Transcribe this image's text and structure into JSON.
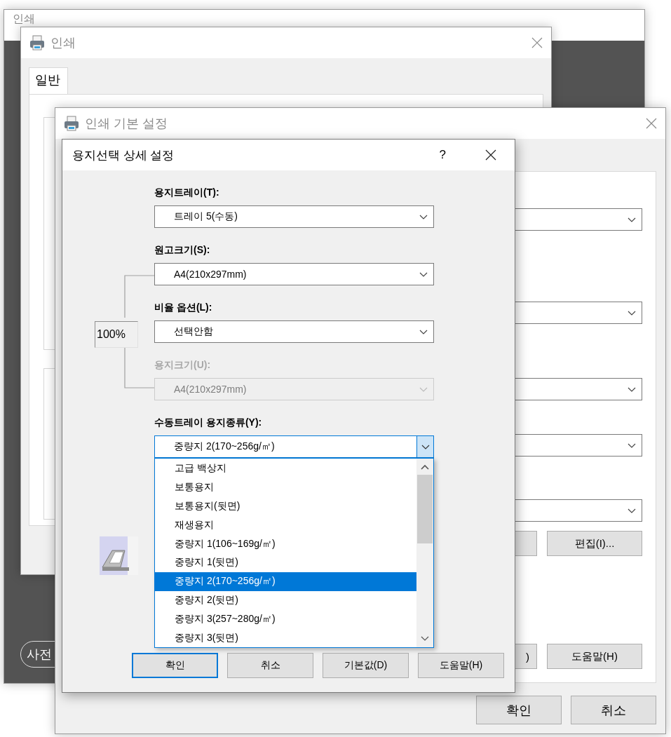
{
  "background_window": {
    "title": "인쇄",
    "button": "사전"
  },
  "print_window": {
    "title": "인쇄",
    "tabs": [
      {
        "label": "일반",
        "selected": true
      }
    ]
  },
  "preferences_window": {
    "title": "인쇄 기본 설정",
    "combo_boxes": [
      {
        "kind": "combo"
      },
      {
        "kind": "combo"
      },
      {
        "kind": "combo"
      },
      {
        "kind": "combo"
      },
      {
        "kind": "combo"
      }
    ],
    "button_rows": [
      {
        "buttons": [
          {
            "kind": "blank"
          },
          {
            "kind": "text",
            "label": "편집(I)..."
          }
        ]
      },
      {
        "buttons": [
          {
            "kind": "text",
            "label": ")"
          },
          {
            "kind": "text",
            "label": "도움말(H)"
          }
        ]
      }
    ],
    "footer_buttons": [
      "확인",
      "취소"
    ]
  },
  "paper_dialog": {
    "title": "용지선택 상세 설정",
    "help": "?",
    "scale": "100%",
    "fields": [
      {
        "label": "용지트레이(T):",
        "value": "트레이 5(수동)",
        "disabled": false,
        "expanded": false
      },
      {
        "label": "원고크기(S):",
        "value": "A4(210x297mm)",
        "disabled": false,
        "expanded": false
      },
      {
        "label": "비율 옵션(L):",
        "value": "선택안함",
        "disabled": false,
        "expanded": false
      },
      {
        "label": "용지크기(U):",
        "value": "A4(210x297mm)",
        "disabled": true,
        "expanded": false
      },
      {
        "label": "수동트레이 용지종류(Y):",
        "value": "중량지 2(170~256g/㎡)",
        "disabled": false,
        "expanded": true,
        "options": [
          {
            "label": "고급 백상지",
            "selected": false
          },
          {
            "label": "보통용지",
            "selected": false
          },
          {
            "label": "보통용지(뒷면)",
            "selected": false
          },
          {
            "label": "재생용지",
            "selected": false
          },
          {
            "label": "중량지 1(106~169g/㎡)",
            "selected": false
          },
          {
            "label": "중량지 1(뒷면)",
            "selected": false
          },
          {
            "label": "중량지 2(170~256g/㎡)",
            "selected": true
          },
          {
            "label": "중량지 2(뒷면)",
            "selected": false
          },
          {
            "label": "중량지 3(257~280g/㎡)",
            "selected": false
          },
          {
            "label": "중량지 3(뒷면)",
            "selected": false
          }
        ]
      }
    ],
    "buttons": [
      {
        "label": "확인",
        "default": true
      },
      {
        "label": "취소",
        "default": false
      },
      {
        "label": "기본값(D)",
        "default": false
      },
      {
        "label": "도움말(H)",
        "default": false
      }
    ]
  }
}
